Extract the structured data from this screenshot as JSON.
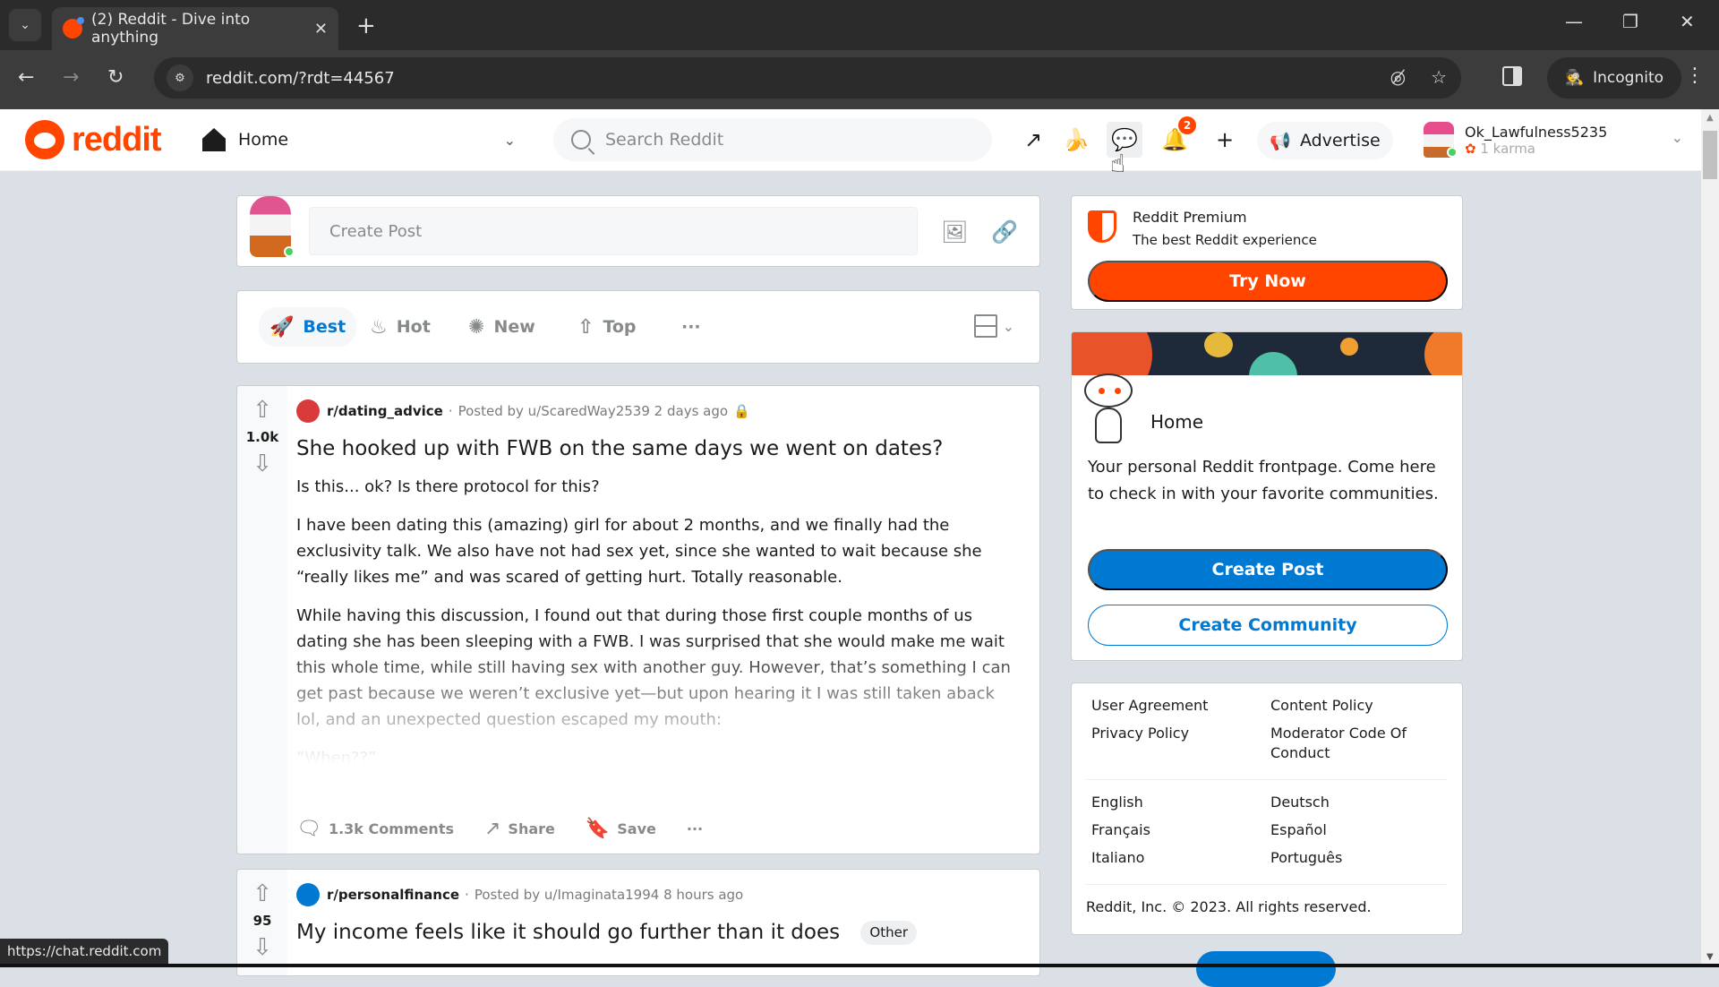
{
  "browser": {
    "tab_title": "(2) Reddit - Dive into anything",
    "url": "reddit.com/?rdt=44567",
    "incognito_label": "Incognito",
    "status_url": "https://chat.reddit.com",
    "icons": {
      "tab_list": "⌄",
      "tab_close": "✕",
      "new_tab": "+",
      "minimize": "—",
      "restore": "❐",
      "close": "✕",
      "back": "←",
      "forward": "→",
      "reload": "↻",
      "site_info": "⚙",
      "eye_off": "◎̸",
      "star": "☆",
      "incognito": "🕵",
      "menu": "⋮"
    }
  },
  "header": {
    "logo_text": "reddit",
    "feed_label": "Home",
    "search_placeholder": "Search Reddit",
    "notification_count": "2",
    "advertise_label": "Advertise",
    "username": "Ok_Lawfulness5235",
    "karma": "1 karma",
    "icons": {
      "popular": "↗",
      "coins": "🍌",
      "chat": "💬",
      "bell": "🔔",
      "create": "+",
      "advertise": "📢",
      "chevron": "⌄"
    }
  },
  "create_post": {
    "placeholder": "Create Post",
    "image_icon": "🖼",
    "link_icon": "🔗"
  },
  "sort": {
    "tabs": [
      {
        "label": "Best",
        "icon": "🚀",
        "active": true
      },
      {
        "label": "Hot",
        "icon": "♨",
        "active": false
      },
      {
        "label": "New",
        "icon": "✺",
        "active": false
      },
      {
        "label": "Top",
        "icon": "⇧",
        "active": false
      }
    ],
    "more": "···"
  },
  "posts": [
    {
      "subreddit": "r/dating_advice",
      "posted_by": "Posted by u/ScaredWay2539",
      "time": "2 days ago",
      "votes": "1.0k",
      "title": "She hooked up with FWB on the same days we went on dates?",
      "paragraphs": [
        "Is this... ok? Is there protocol for this?",
        "I have been dating this (amazing) girl for about 2 months, and we finally had the exclusivity talk. We also have not had sex yet, since she wanted to wait because she “really likes me” and was scared of getting hurt. Totally reasonable.",
        "While having this discussion, I found out that during those first couple months of us dating she has been sleeping with a FWB. I was surprised that she would make me wait this whole time, while still having sex with another guy. However, that’s something I can get past because we weren’t exclusive yet—but upon hearing it I was still taken aback lol, and an unexpected question escaped my mouth:",
        "“When??”"
      ],
      "comments": "1.3k Comments",
      "share": "Share",
      "save": "Save",
      "more": "···",
      "icon_color": "#d93a3a"
    },
    {
      "subreddit": "r/personalfinance",
      "posted_by": "Posted by u/Imaginata1994",
      "time": "8 hours ago",
      "votes": "95",
      "title": "My income feels like it should go further than it does",
      "flair": "Other",
      "icon_color": "#0079d3"
    }
  ],
  "premium": {
    "title": "Reddit Premium",
    "subtitle": "The best Reddit experience",
    "button": "Try Now"
  },
  "home_card": {
    "title": "Home",
    "description": "Your personal Reddit frontpage. Come here to check in with your favorite communities.",
    "create_post": "Create Post",
    "create_community": "Create Community"
  },
  "footer": {
    "links_left": [
      "User Agreement",
      "Privacy Policy"
    ],
    "links_right": [
      "Content Policy",
      "Moderator Code Of Conduct"
    ],
    "languages_left": [
      "English",
      "Français",
      "Italiano"
    ],
    "languages_right": [
      "Deutsch",
      "Español",
      "Português"
    ],
    "copyright": "Reddit, Inc. © 2023. All rights reserved."
  },
  "colors": {
    "brand": "#ff4500",
    "accent": "#0079d3",
    "background": "#dae0e6"
  }
}
